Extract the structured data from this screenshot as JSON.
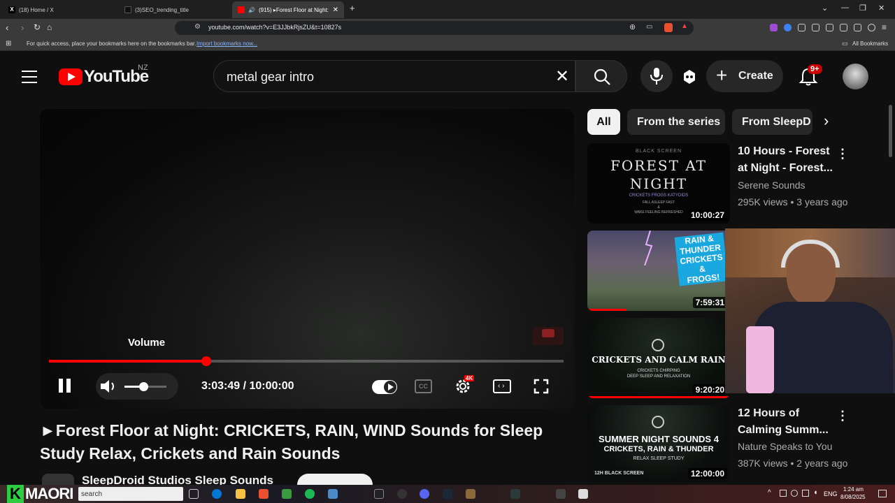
{
  "browser": {
    "tabs": [
      {
        "label": "(18) Home / X",
        "icon": "x-logo-icon",
        "active": false
      },
      {
        "label": "(3)SEO_trending_title",
        "icon": "tiktok-icon",
        "active": false
      },
      {
        "label": "(915) ▸Forest Floor at Night:",
        "icon": "youtube-icon",
        "active": true
      }
    ],
    "url": "youtube.com/watch?v=E3JJbkRjsZU&t=10827s",
    "bookmarks_hint": "For quick access, place your bookmarks here on the bookmarks bar.",
    "bookmarks_link": "Import bookmarks now...",
    "all_bookmarks": "All Bookmarks"
  },
  "youtube": {
    "logo_text": "YouTube",
    "region": "NZ",
    "search_value": "metal gear intro",
    "create_label": "Create",
    "notif_count": "9+"
  },
  "player": {
    "volume_tooltip": "Volume",
    "time_current": "3:03:49",
    "time_sep": " / ",
    "time_total": "10:00:00",
    "progress_fraction": 0.3063,
    "volume_fraction": 0.45,
    "quality_badge": "4K"
  },
  "video": {
    "title": "►Forest Floor at Night: CRICKETS, RAIN, WIND Sounds for Sleep Study Relax, Crickets and Rain Sounds",
    "channel": "SleepDroid Studios Sleep Sounds"
  },
  "chips": [
    "All",
    "From the series",
    "From SleepD"
  ],
  "recommendations": [
    {
      "thumb_lines": [
        "BLACK SCREEN",
        "FOREST AT",
        "NIGHT",
        "CRICKETS FROGS KATYDIDS",
        "FALL ASLEEP FAST",
        "&",
        "WAKE FEELING REFRESHED"
      ],
      "duration": "10:00:27",
      "title": "10 Hours - Forest at Night - Forest...",
      "channel": "Serene Sounds",
      "meta": "295K views • 3 years ago"
    },
    {
      "thumb_lines": [
        "RAIN &",
        "THUNDER",
        "CRICKETS &",
        "FROGS!"
      ],
      "duration": "7:59:31"
    },
    {
      "thumb_lines": [
        "CRICKETS AND CALM RAIN",
        "CRICKETS CHIRPING",
        "DEEP SLEEP AND RELAXATION"
      ],
      "duration": "9:20:20"
    },
    {
      "thumb_lines": [
        "SUMMER NIGHT SOUNDS 4",
        "CRICKETS, RAIN & THUNDER",
        "RELAX SLEEP STUDY",
        "12H BLACK SCREEN"
      ],
      "duration": "12:00:00",
      "title": "12 Hours of Calming Summ...",
      "channel": "Nature Speaks to You",
      "meta": "387K views • 2 years ago"
    }
  ],
  "taskbar": {
    "brand": "MAORI",
    "search_placeholder": "search",
    "lang": "ENG",
    "time": "1:24 am",
    "date": "8/08/2025"
  }
}
